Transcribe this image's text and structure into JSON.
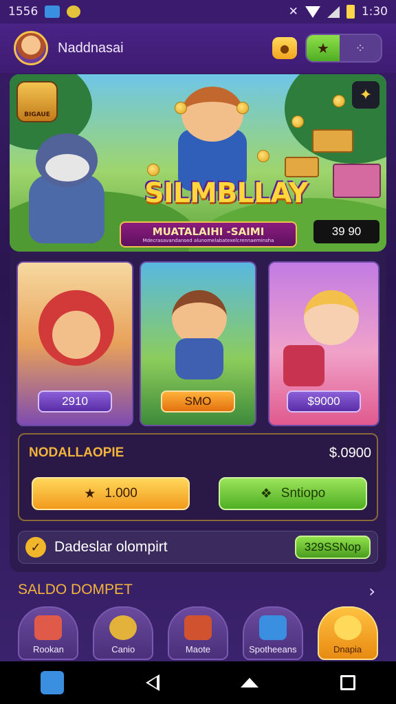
{
  "status_bar": {
    "left_text": "1556",
    "time": "1:30"
  },
  "header": {
    "username": "Naddnasai"
  },
  "hero": {
    "badge_text": "BIGAUE",
    "logo_text": "SILMBLLAY",
    "ribbon_main": "MUATALAIHI -SAIMI",
    "ribbon_sub": "Mdecrasavandansed alunomelabatexelcrennaeminsha",
    "price": "39 90"
  },
  "cards": [
    {
      "price": "2910",
      "style": "purple"
    },
    {
      "price": "SMO",
      "style": "orange"
    },
    {
      "price": "$9000",
      "style": "purple"
    }
  ],
  "purchase": {
    "label": "NODALLAOPIE",
    "amount": "$.0900",
    "gold_button": "1.000",
    "green_button": "Sntiopo"
  },
  "wallet": {
    "text": "Dadeslar olompirt",
    "pill": "329SSNop"
  },
  "section": {
    "title": "SALDO DOMPET",
    "arrow": "›"
  },
  "tabs": [
    {
      "label": "Rookan",
      "active": false
    },
    {
      "label": "Canio",
      "active": false
    },
    {
      "label": "Maote",
      "active": false
    },
    {
      "label": "Spotheeans",
      "active": false
    },
    {
      "label": "Dnapia",
      "active": true
    }
  ],
  "colors": {
    "background": "#2b1550",
    "accent_gold": "#f3b43d",
    "accent_green": "#4fae23",
    "accent_purple": "#5a2ea6"
  }
}
